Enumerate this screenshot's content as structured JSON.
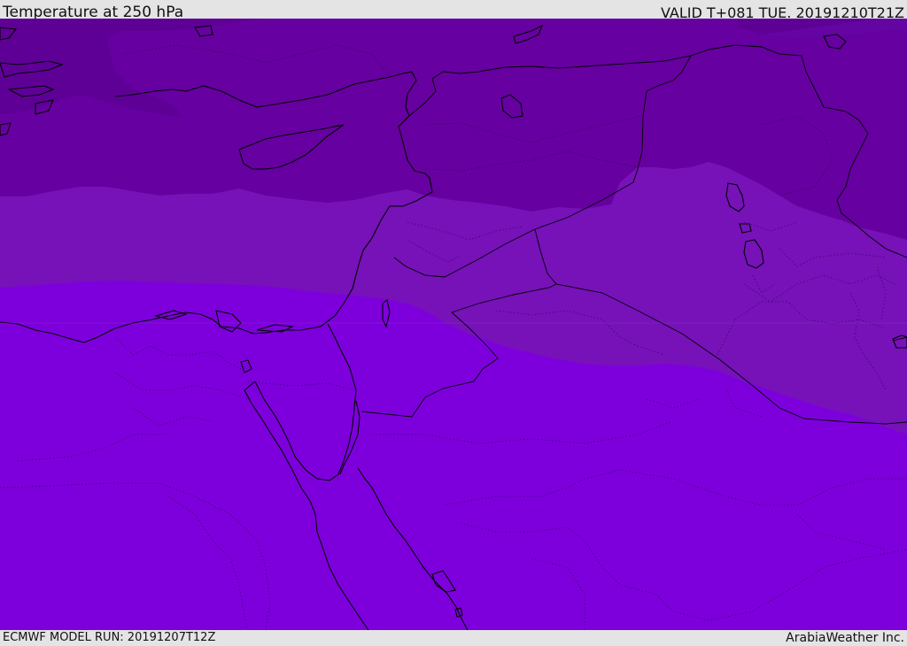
{
  "header": {
    "title": "Temperature at 250 hPa",
    "valid": "VALID T+081 TUE. 20191210T21Z"
  },
  "footer": {
    "model_run": "ECMWF MODEL RUN: 20191207T12Z",
    "credit": "ArabiaWeather Inc."
  },
  "map": {
    "region": "Eastern Mediterranean, Levant, Egypt and Arabia",
    "colors": {
      "band_darkest": "#5e0096",
      "band_dark": "#6600a0",
      "band_mid": "#7612b8",
      "band_light": "#7d00dc",
      "coastline": "#000000",
      "border": "#1a0030"
    }
  }
}
